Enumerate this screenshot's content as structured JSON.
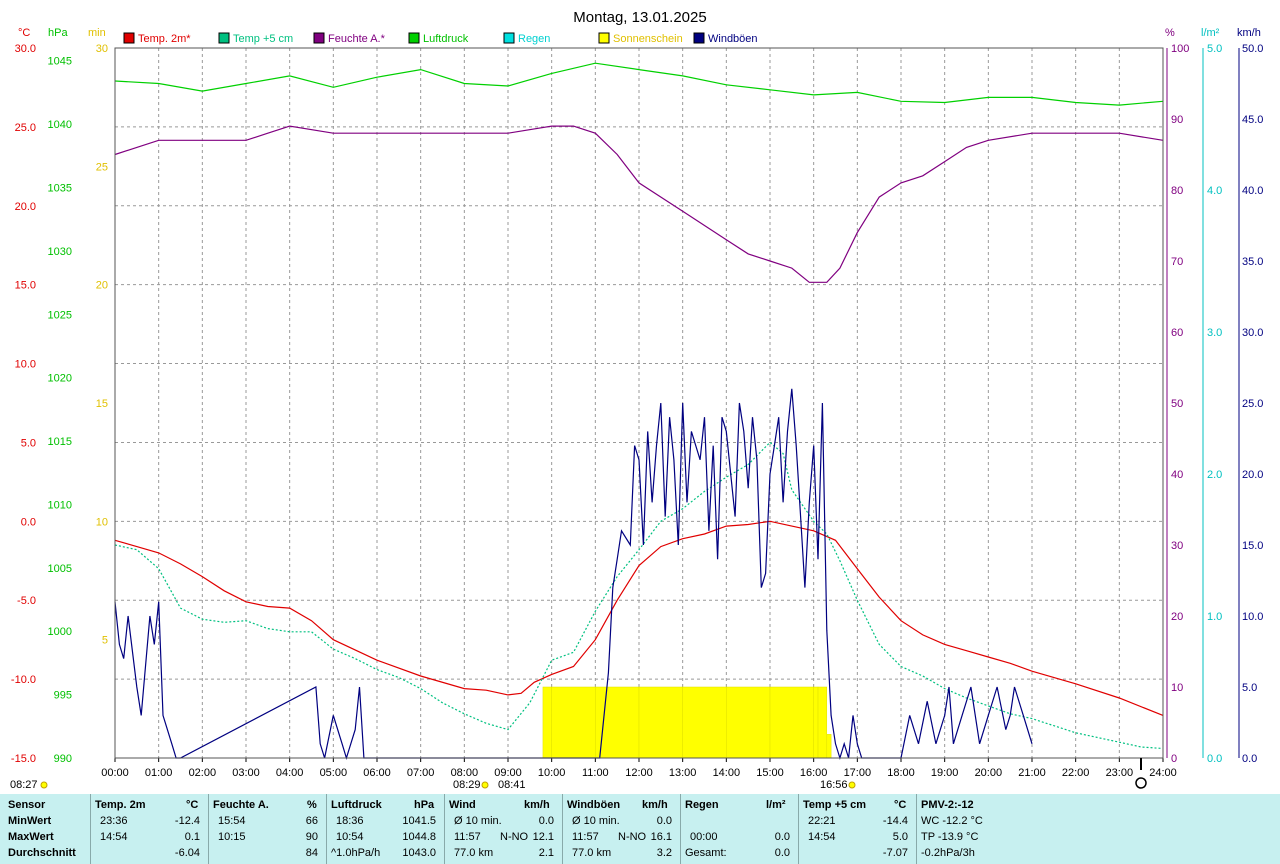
{
  "title": "Montag, 13.01.2025",
  "legend": [
    {
      "label": "Temp. 2m*",
      "color": "#e00000"
    },
    {
      "label": "Temp +5 cm",
      "color": "#00c080"
    },
    {
      "label": "Feuchte A.*",
      "color": "#800080"
    },
    {
      "label": "Luftdruck",
      "color": "#00d000"
    },
    {
      "label": "Regen",
      "color": "#00e0e0"
    },
    {
      "label": "Sonnenschein",
      "color": "#ffff00"
    },
    {
      "label": "Windböen",
      "color": "#000080"
    }
  ],
  "axis_units": {
    "temp": "°C",
    "pressure": "hPa",
    "sun": "min",
    "humidity": "%",
    "rain": "l/m²",
    "wind": "km/h"
  },
  "chart_data": {
    "type": "line",
    "title": "Montag, 13.01.2025",
    "x_ticks": [
      "00:00",
      "01:00",
      "02:00",
      "03:00",
      "04:00",
      "05:00",
      "06:00",
      "07:00",
      "08:00",
      "09:00",
      "10:00",
      "11:00",
      "12:00",
      "13:00",
      "14:00",
      "15:00",
      "16:00",
      "17:00",
      "18:00",
      "19:00",
      "20:00",
      "21:00",
      "22:00",
      "23:00",
      "24:00"
    ],
    "axes": {
      "temp": {
        "unit": "°C",
        "range": [
          -15,
          30
        ],
        "ticks": [
          "30.0",
          "25.0",
          "20.0",
          "15.0",
          "10.0",
          "5.0",
          "0.0",
          "-5.0",
          "-10.0",
          "-15.0"
        ]
      },
      "pressure": {
        "unit": "hPa",
        "range": [
          990,
          1046
        ],
        "ticks": [
          "1045",
          "1040",
          "1035",
          "1030",
          "1025",
          "1020",
          "1015",
          "1010",
          "1005",
          "1000",
          "995",
          "990"
        ]
      },
      "sun": {
        "unit": "min",
        "range": [
          0,
          30
        ],
        "ticks": [
          "30",
          "25",
          "20",
          "15",
          "10",
          "5"
        ]
      },
      "humidity": {
        "unit": "%",
        "range": [
          0,
          100
        ],
        "ticks": [
          "100",
          "90",
          "80",
          "70",
          "60",
          "50",
          "40",
          "30",
          "20",
          "10",
          "0"
        ]
      },
      "rain": {
        "unit": "l/m²",
        "range": [
          0,
          5
        ],
        "ticks": [
          "5.0",
          "4.0",
          "3.0",
          "2.0",
          "1.0",
          "0.0"
        ]
      },
      "wind": {
        "unit": "km/h",
        "range": [
          0,
          50
        ],
        "ticks": [
          "50.0",
          "45.0",
          "40.0",
          "35.0",
          "30.0",
          "25.0",
          "20.0",
          "15.0",
          "10.0",
          "5.0",
          "0.0"
        ]
      }
    },
    "series": [
      {
        "name": "Temp. 2m*",
        "axis": "temp",
        "color": "#e00000",
        "x": [
          0,
          0.5,
          1,
          1.5,
          2,
          2.5,
          3,
          3.5,
          4,
          4.5,
          5,
          6,
          7,
          8,
          8.5,
          9,
          9.3,
          9.6,
          10,
          10.5,
          11,
          11.5,
          12,
          12.5,
          13,
          13.5,
          14,
          14.5,
          15,
          15.5,
          16,
          16.5,
          17,
          17.5,
          18,
          18.5,
          19,
          19.5,
          20,
          20.5,
          21,
          22,
          23,
          24
        ],
        "y": [
          -1.2,
          -1.6,
          -2.0,
          -2.7,
          -3.5,
          -4.4,
          -5.1,
          -5.4,
          -5.5,
          -6.3,
          -7.5,
          -8.8,
          -9.8,
          -10.6,
          -10.7,
          -11.0,
          -10.9,
          -10.2,
          -9.7,
          -9.2,
          -7.5,
          -5.0,
          -2.8,
          -1.6,
          -1.1,
          -0.8,
          -0.3,
          -0.2,
          0.0,
          -0.3,
          -0.6,
          -1.2,
          -3.0,
          -4.8,
          -6.3,
          -7.2,
          -7.8,
          -8.2,
          -8.6,
          -9.0,
          -9.5,
          -10.3,
          -11.2,
          -12.3
        ]
      },
      {
        "name": "Temp +5 cm",
        "axis": "temp",
        "color": "#00c080",
        "x": [
          0,
          0.5,
          1,
          1.3,
          1.5,
          2,
          2.5,
          3,
          3.5,
          4,
          4.5,
          5,
          5.5,
          6,
          6.5,
          7,
          7.5,
          8,
          8.5,
          9,
          9.5,
          10,
          10.5,
          11,
          11.5,
          12,
          12.5,
          13,
          13.5,
          14,
          14.5,
          15,
          15.3,
          15.5,
          16,
          16.3,
          16.6,
          17,
          17.5,
          18,
          18.5,
          19,
          19.5,
          20,
          20.5,
          21,
          22,
          23,
          23.5,
          24
        ],
        "y": [
          -1.5,
          -1.8,
          -3.0,
          -4.5,
          -5.5,
          -6.2,
          -6.4,
          -6.3,
          -6.8,
          -7.0,
          -7.0,
          -8.1,
          -8.7,
          -9.4,
          -9.9,
          -10.6,
          -11.5,
          -12.2,
          -12.8,
          -13.2,
          -11.5,
          -8.8,
          -8.3,
          -5.7,
          -3.5,
          -1.8,
          0.0,
          0.8,
          1.9,
          2.8,
          3.6,
          5.0,
          4.3,
          2.0,
          0.0,
          -0.8,
          -2.5,
          -5.0,
          -7.8,
          -9.2,
          -9.8,
          -10.6,
          -11.2,
          -11.7,
          -12.2,
          -12.5,
          -13.4,
          -14.0,
          -14.3,
          -14.4
        ]
      },
      {
        "name": "Feuchte A.*",
        "axis": "humidity",
        "color": "#800080",
        "x": [
          0,
          0.5,
          1,
          2,
          3,
          3.5,
          4,
          5,
          6,
          7,
          8,
          9,
          10,
          10.5,
          11,
          11.5,
          12,
          13,
          14,
          14.5,
          15,
          15.5,
          15.9,
          16.3,
          16.6,
          17,
          17.5,
          18,
          18.5,
          19,
          19.5,
          20,
          21,
          22,
          23,
          24
        ],
        "y": [
          85,
          86,
          87,
          87,
          87,
          88,
          89,
          88,
          88,
          88,
          88,
          88,
          89,
          89,
          88,
          85,
          81,
          77,
          73,
          71,
          70,
          69,
          67,
          67,
          69,
          74,
          79,
          81,
          82,
          84,
          86,
          87,
          88,
          88,
          88,
          87
        ]
      },
      {
        "name": "Luftdruck",
        "axis": "pressure",
        "color": "#00d000",
        "x": [
          0,
          1,
          2,
          3,
          4,
          5,
          6,
          7,
          8,
          9,
          10,
          11,
          12,
          13,
          14,
          15,
          16,
          17,
          18,
          19,
          20,
          21,
          22,
          23,
          24
        ],
        "y": [
          1043.4,
          1043.2,
          1042.6,
          1043.2,
          1043.8,
          1042.9,
          1043.7,
          1044.3,
          1043.2,
          1043.0,
          1044.0,
          1044.8,
          1044.3,
          1043.8,
          1043.1,
          1042.7,
          1042.3,
          1042.5,
          1041.8,
          1041.7,
          1042.1,
          1042.1,
          1041.7,
          1041.5,
          1041.8
        ]
      },
      {
        "name": "Windböen",
        "axis": "wind",
        "color": "#000080",
        "x": [
          0,
          0.1,
          0.2,
          0.3,
          0.5,
          0.6,
          0.8,
          0.9,
          1.0,
          1.1,
          1.3,
          1.4,
          1.5,
          4.6,
          4.7,
          4.8,
          5.0,
          5.2,
          5.3,
          5.5,
          5.6,
          5.7,
          11.1,
          11.3,
          11.4,
          11.5,
          11.6,
          11.8,
          11.9,
          12.0,
          12.1,
          12.2,
          12.3,
          12.4,
          12.5,
          12.6,
          12.7,
          12.8,
          12.9,
          13.0,
          13.1,
          13.2,
          13.4,
          13.5,
          13.6,
          13.7,
          13.8,
          13.9,
          14.0,
          14.2,
          14.3,
          14.4,
          14.5,
          14.6,
          14.7,
          14.8,
          14.9,
          15.0,
          15.1,
          15.2,
          15.3,
          15.4,
          15.5,
          15.6,
          15.7,
          15.8,
          15.9,
          16.0,
          16.1,
          16.2,
          16.3,
          16.4,
          16.5,
          16.6,
          16.7,
          16.8,
          16.9,
          17.0,
          17.1,
          18.0,
          18.2,
          18.4,
          18.6,
          18.8,
          19.0,
          19.1,
          19.2,
          19.4,
          19.6,
          19.8,
          20.0,
          20.2,
          20.4,
          20.5,
          20.6,
          20.8,
          21.0
        ],
        "y": [
          11,
          8,
          7,
          10,
          5,
          3,
          10,
          8,
          11,
          3,
          1,
          0,
          0,
          5,
          1,
          0,
          3,
          1,
          0,
          2,
          5,
          0,
          0,
          6,
          12,
          14,
          16,
          15,
          22,
          21,
          15,
          23,
          18,
          22,
          25,
          17,
          24,
          21,
          15,
          25,
          18,
          23,
          21,
          24,
          16,
          22,
          14,
          24,
          23,
          17,
          25,
          23,
          19,
          24,
          21,
          12,
          13,
          20,
          22,
          24,
          18,
          23,
          26,
          22,
          17,
          12,
          18,
          22,
          14,
          25,
          9,
          3,
          1,
          0,
          1,
          0,
          3,
          1,
          0,
          0,
          3,
          1,
          4,
          1,
          3,
          5,
          1,
          3,
          5,
          1,
          3,
          5,
          2,
          3,
          5,
          3,
          1
        ]
      }
    ],
    "sunshine": {
      "axis": "sun",
      "color": "#ffff00",
      "from": "09:49",
      "to": "16:26",
      "x": [
        9.8,
        10,
        11,
        12,
        13,
        14,
        15,
        16,
        16.1,
        16.3,
        16.4
      ],
      "y": [
        3,
        3,
        3,
        3,
        3,
        3,
        3,
        3,
        3,
        1,
        0
      ]
    },
    "sun_markers": {
      "rise": "08:27",
      "twilight": [
        "08:29",
        "08:41"
      ],
      "set": "16:56"
    }
  },
  "summary": {
    "headers": {
      "sensor": "Sensor",
      "temp": "Temp. 2m",
      "temp_unit": "°C",
      "hum": "Feuchte A.",
      "hum_unit": "%",
      "press": "Luftdruck",
      "press_unit": "hPa",
      "wind": "Wind",
      "wind_unit": "km/h",
      "gust": "Windböen",
      "gust_unit": "km/h",
      "rain": "Regen",
      "rain_unit": "l/m²",
      "t5": "Temp +5 cm",
      "t5_unit": "°C",
      "pmv": "PMV-2:-12"
    },
    "rows": {
      "min": "MinWert",
      "max": "MaxWert",
      "avg": "Durchschnitt"
    },
    "temp": {
      "min_t": "23:36",
      "min_v": "-12.4",
      "max_t": "14:54",
      "max_v": "0.1",
      "avg_v": "-6.04"
    },
    "hum": {
      "min_t": "15:54",
      "min_v": "66",
      "max_t": "10:15",
      "max_v": "90",
      "avg_v": "84"
    },
    "press": {
      "min_t": "18:36",
      "min_v": "1041.5",
      "max_t": "10:54",
      "max_v": "1044.8",
      "avg_l": "^1.0hPa/h",
      "avg_v": "1043.0"
    },
    "wind": {
      "l1": "Ø 10 min.",
      "v1": "0.0",
      "t2": "11:57",
      "d2": "N-NO",
      "v2": "12.1",
      "l3": "77.0 km",
      "v3": "2.1"
    },
    "gust": {
      "l1": "Ø 10 min.",
      "v1": "0.0",
      "t2": "11:57",
      "d2": "N-NO",
      "v2": "16.1",
      "l3": "77.0 km",
      "v3": "3.2"
    },
    "rain": {
      "t2": "00:00",
      "v2": "0.0",
      "l3": "Gesamt:",
      "v3": "0.0"
    },
    "t5": {
      "min_t": "22:21",
      "min_v": "-14.4",
      "max_t": "14:54",
      "max_v": "5.0",
      "avg_v": "-7.07"
    },
    "pmv": {
      "l1": "WC -12.2 °C",
      "l2": "TP -13.9 °C",
      "l3": "-0.2hPa/3h"
    }
  }
}
